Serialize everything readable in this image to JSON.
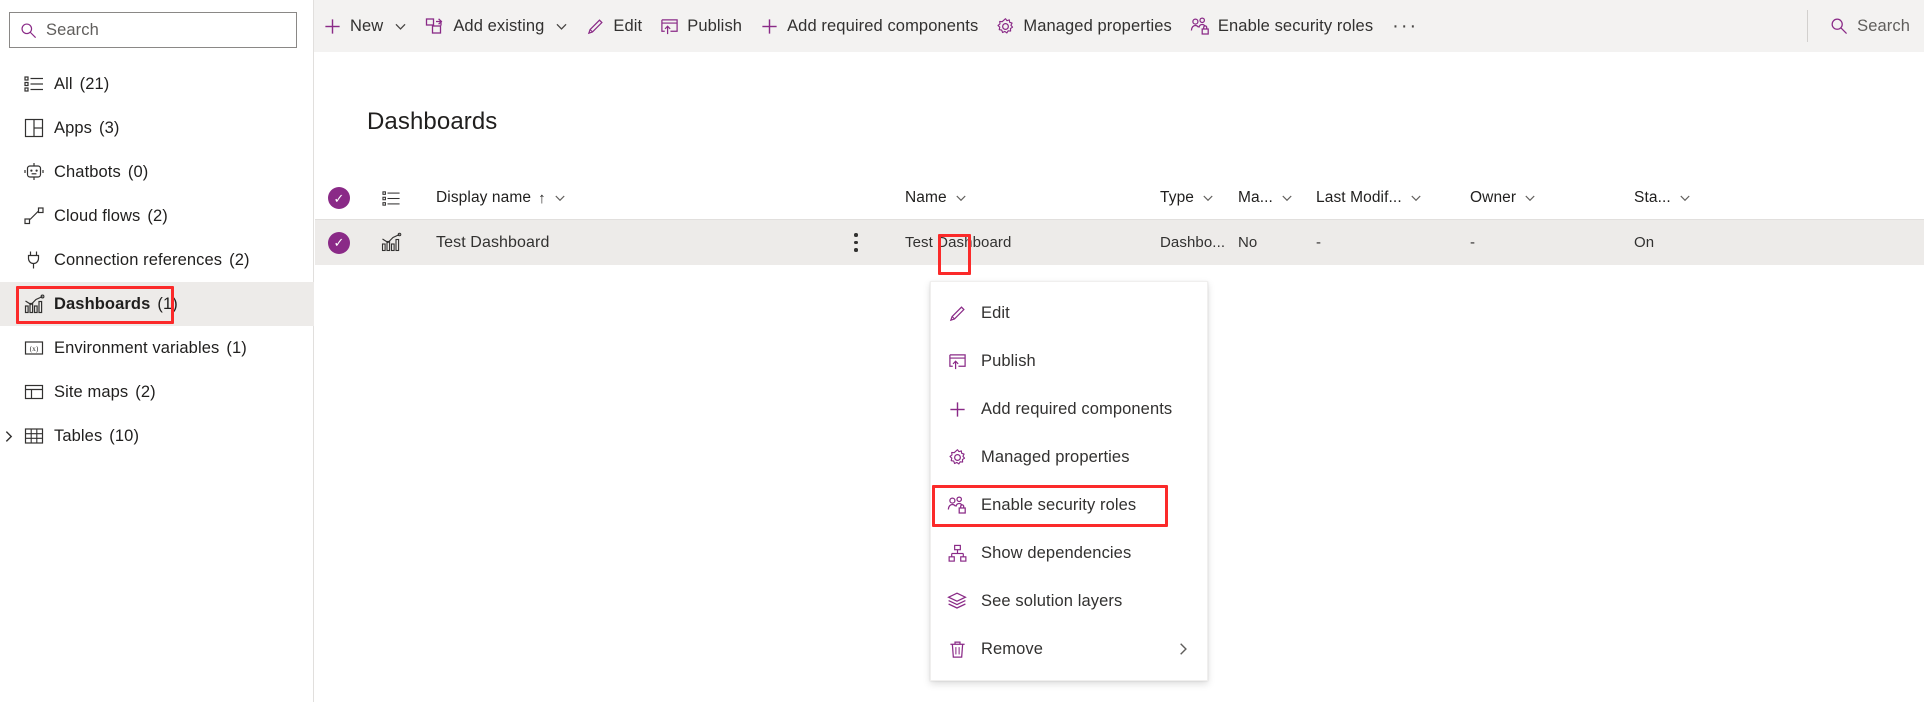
{
  "colors": {
    "accent": "#8a2a87",
    "highlight_box": "#fb2a2a",
    "toolbar_bg": "#f3f2f1",
    "row_selected_bg": "#edebe9",
    "text": "#323130"
  },
  "sidebar": {
    "search": {
      "placeholder": "Search",
      "value": "",
      "icon": "search-icon"
    },
    "items": [
      {
        "icon": "list-icon",
        "label": "All",
        "count": "(21)",
        "selected": false,
        "expandable": false
      },
      {
        "icon": "apps-grid-icon",
        "label": "Apps",
        "count": "(3)",
        "selected": false,
        "expandable": false
      },
      {
        "icon": "chatbot-icon",
        "label": "Chatbots",
        "count": "(0)",
        "selected": false,
        "expandable": false
      },
      {
        "icon": "cloud-flow-icon",
        "label": "Cloud flows",
        "count": "(2)",
        "selected": false,
        "expandable": false
      },
      {
        "icon": "plug-icon",
        "label": "Connection references",
        "count": "(2)",
        "selected": false,
        "expandable": false
      },
      {
        "icon": "dashboard-chart-icon",
        "label": "Dashboards",
        "count": "(1)",
        "selected": true,
        "expandable": false
      },
      {
        "icon": "environment-variable-icon",
        "label": "Environment variables",
        "count": "(1)",
        "selected": false,
        "expandable": false
      },
      {
        "icon": "site-map-icon",
        "label": "Site maps",
        "count": "(2)",
        "selected": false,
        "expandable": false
      },
      {
        "icon": "table-icon",
        "label": "Tables",
        "count": "(10)",
        "selected": false,
        "expandable": true
      }
    ]
  },
  "toolbar": {
    "items": [
      {
        "icon": "plus-icon",
        "label": "New",
        "chevron": true
      },
      {
        "icon": "add-existing-icon",
        "label": "Add existing",
        "chevron": true
      },
      {
        "icon": "pencil-icon",
        "label": "Edit",
        "chevron": false
      },
      {
        "icon": "publish-icon",
        "label": "Publish",
        "chevron": false
      },
      {
        "icon": "plus-icon",
        "label": "Add required components",
        "chevron": false
      },
      {
        "icon": "gear-icon",
        "label": "Managed properties",
        "chevron": false
      },
      {
        "icon": "security-roles-icon",
        "label": "Enable security roles",
        "chevron": false
      }
    ],
    "overflow_label": "···",
    "search": {
      "placeholder": "Search",
      "value": "",
      "icon": "search-icon"
    }
  },
  "main": {
    "title": "Dashboards",
    "grid": {
      "headers": [
        {
          "key": "select",
          "label": "",
          "chevron": false,
          "sorted": false
        },
        {
          "key": "icon",
          "label": "",
          "chevron": false,
          "sorted": false
        },
        {
          "key": "display",
          "label": "Display name",
          "chevron": true,
          "sorted": true,
          "sort_dir": "↑"
        },
        {
          "key": "cmd",
          "label": "",
          "chevron": false,
          "sorted": false
        },
        {
          "key": "name",
          "label": "Name",
          "chevron": true,
          "sorted": false
        },
        {
          "key": "type",
          "label": "Type",
          "chevron": true,
          "sorted": false
        },
        {
          "key": "managed",
          "label": "Ma...",
          "chevron": true,
          "sorted": false
        },
        {
          "key": "modif",
          "label": "Last Modif...",
          "chevron": true,
          "sorted": false
        },
        {
          "key": "owner",
          "label": "Owner",
          "chevron": true,
          "sorted": false
        },
        {
          "key": "status",
          "label": "Sta...",
          "chevron": true,
          "sorted": false
        }
      ],
      "rows": [
        {
          "selected": true,
          "row_icon": "dashboard-chart-icon",
          "display_name": "Test Dashboard",
          "name": "Test Dashboard",
          "type": "Dashbo...",
          "managed": "No",
          "last_modified": "-",
          "owner": "-",
          "status": "On"
        }
      ]
    }
  },
  "context_menu": {
    "items": [
      {
        "icon": "pencil-icon",
        "label": "Edit",
        "submenu": false,
        "highlighted": false
      },
      {
        "icon": "publish-icon",
        "label": "Publish",
        "submenu": false,
        "highlighted": false
      },
      {
        "icon": "plus-icon",
        "label": "Add required components",
        "submenu": false,
        "highlighted": false
      },
      {
        "icon": "gear-icon",
        "label": "Managed properties",
        "submenu": false,
        "highlighted": false
      },
      {
        "icon": "security-roles-icon",
        "label": "Enable security roles",
        "submenu": false,
        "highlighted": true
      },
      {
        "icon": "dependencies-icon",
        "label": "Show dependencies",
        "submenu": false,
        "highlighted": false
      },
      {
        "icon": "layers-icon",
        "label": "See solution layers",
        "submenu": false,
        "highlighted": false
      },
      {
        "icon": "trash-icon",
        "label": "Remove",
        "submenu": true,
        "highlighted": false
      }
    ],
    "submenu_chevron": "›"
  }
}
